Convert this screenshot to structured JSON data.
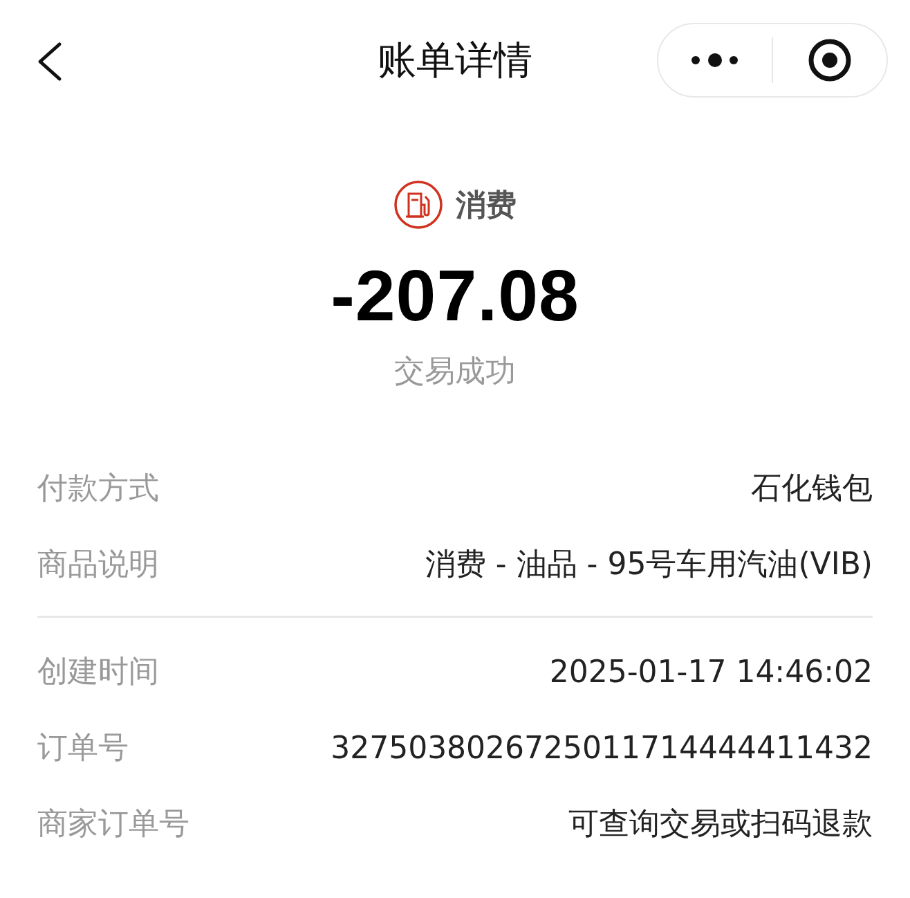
{
  "header": {
    "title": "账单详情"
  },
  "summary": {
    "category": "消费",
    "amount": "-207.08",
    "status": "交易成功"
  },
  "sections": [
    {
      "rows": [
        {
          "label": "付款方式",
          "value": "石化钱包"
        },
        {
          "label": "商品说明",
          "value": "消费 - 油品 - 95号车用汽油(VIB)"
        }
      ]
    },
    {
      "rows": [
        {
          "label": "创建时间",
          "value": "2025-01-17 14:46:02"
        },
        {
          "label": "订单号",
          "value": "3275038026725011714444411432"
        },
        {
          "label": "商家订单号",
          "value": "可查询交易或扫码退款"
        }
      ]
    }
  ]
}
